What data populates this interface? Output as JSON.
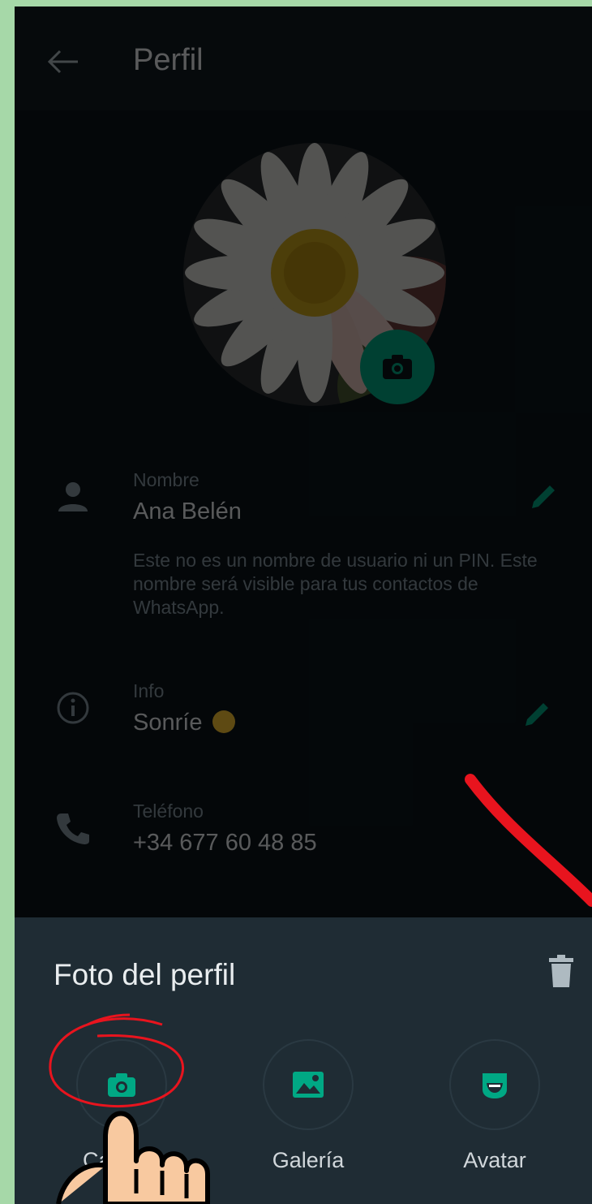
{
  "header": {
    "title": "Perfil"
  },
  "profile": {
    "name": {
      "label": "Nombre",
      "value": "Ana Belén",
      "note": "Este no es un nombre de usuario ni un PIN. Este nombre será visible para tus contactos de WhatsApp."
    },
    "info": {
      "label": "Info",
      "value": "Sonríe"
    },
    "phone": {
      "label": "Teléfono",
      "value": "+34 677 60 48 85"
    }
  },
  "sheet": {
    "title": "Foto del perfil",
    "options": [
      {
        "label": "Cámara",
        "icon": "camera-icon"
      },
      {
        "label": "Galería",
        "icon": "gallery-icon"
      },
      {
        "label": "Avatar",
        "icon": "avatar-icon"
      }
    ]
  },
  "colors": {
    "accent": "#00a884",
    "background": "#0b141a",
    "sheet": "#1f2c34",
    "annotation": "#e8141e",
    "frame": "#a6d8a8"
  }
}
